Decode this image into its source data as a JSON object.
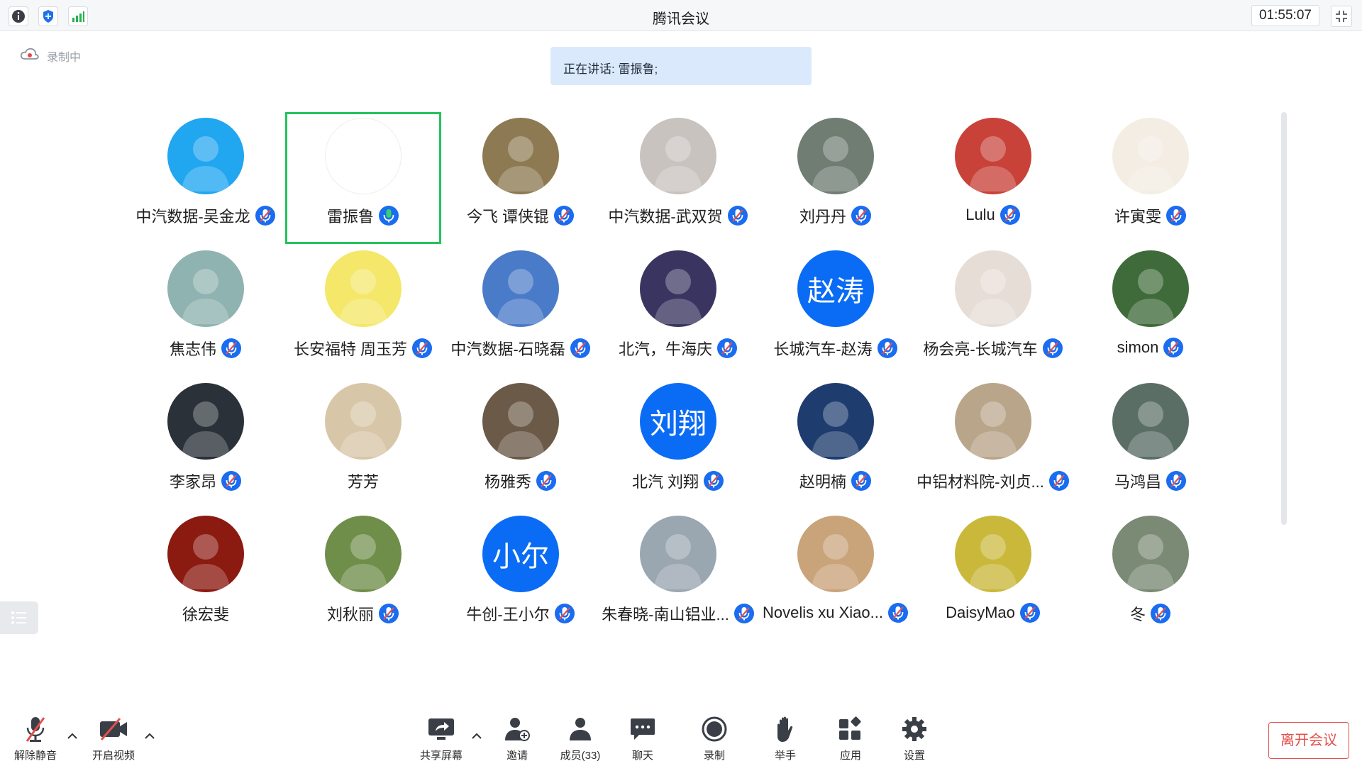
{
  "window": {
    "title": "腾讯会议",
    "timer": "01:55:07",
    "icons": [
      "info-icon",
      "shield-icon",
      "signal-icon"
    ]
  },
  "recording": {
    "label": "录制中"
  },
  "speaking": {
    "prefix": "正在讲话: ",
    "names": "雷振鲁;"
  },
  "participants": [
    {
      "name": "中汽数据-吴金龙",
      "avatar": "photo",
      "bg": "#21a6f0",
      "mic": "muted"
    },
    {
      "name": "雷振鲁",
      "avatar": "photo",
      "bg": "#ffffff",
      "mic": "active"
    },
    {
      "name": "今飞 谭侠锟",
      "avatar": "photo",
      "bg": "#8d7a52",
      "mic": "muted"
    },
    {
      "name": "中汽数据-武双贺",
      "avatar": "photo",
      "bg": "#c9c3bf",
      "mic": "muted"
    },
    {
      "name": "刘丹丹",
      "avatar": "photo",
      "bg": "#6f7d73",
      "mic": "muted"
    },
    {
      "name": "Lulu",
      "avatar": "photo",
      "bg": "#c8423a",
      "mic": "muted"
    },
    {
      "name": "许寅雯",
      "avatar": "photo",
      "bg": "#f3ede3",
      "mic": "muted"
    },
    {
      "name": "焦志伟",
      "avatar": "photo",
      "bg": "#8fb3b0",
      "mic": "muted"
    },
    {
      "name": "长安福特 周玉芳",
      "avatar": "photo",
      "bg": "#f4e76a",
      "mic": "muted"
    },
    {
      "name": "中汽数据-石晓磊",
      "avatar": "photo",
      "bg": "#4a7bc8",
      "mic": "muted"
    },
    {
      "name": "北汽，牛海庆",
      "avatar": "photo",
      "bg": "#3a3560",
      "mic": "muted"
    },
    {
      "name": "长城汽车-赵涛",
      "avatar": "text",
      "text": "赵涛",
      "bg": "#0a6cf5",
      "mic": "muted"
    },
    {
      "name": "杨会亮-长城汽车",
      "avatar": "photo",
      "bg": "#e6ddd6",
      "mic": "muted"
    },
    {
      "name": "simon",
      "avatar": "photo",
      "bg": "#3f6b3a",
      "mic": "muted"
    },
    {
      "name": "李家昂",
      "avatar": "photo",
      "bg": "#2a3138",
      "mic": "muted"
    },
    {
      "name": "芳芳",
      "avatar": "photo",
      "bg": "#d8c6a8",
      "mic": "none"
    },
    {
      "name": "杨雅秀",
      "avatar": "photo",
      "bg": "#6b5a48",
      "mic": "muted"
    },
    {
      "name": "北汽 刘翔",
      "avatar": "text",
      "text": "刘翔",
      "bg": "#0a6cf5",
      "mic": "muted"
    },
    {
      "name": "赵明楠",
      "avatar": "photo",
      "bg": "#1e3c6e",
      "mic": "muted"
    },
    {
      "name": "中铝材料院-刘贞...",
      "avatar": "photo",
      "bg": "#b9a58a",
      "mic": "muted"
    },
    {
      "name": "马鸿昌",
      "avatar": "photo",
      "bg": "#5a6e66",
      "mic": "muted"
    },
    {
      "name": "徐宏斐",
      "avatar": "photo",
      "bg": "#8b1a10",
      "mic": "none"
    },
    {
      "name": "刘秋丽",
      "avatar": "photo",
      "bg": "#6f8e4a",
      "mic": "muted"
    },
    {
      "name": "牛创-王小尔",
      "avatar": "text",
      "text": "小尔",
      "bg": "#0a6cf5",
      "mic": "muted"
    },
    {
      "name": "朱春晓-南山铝业...",
      "avatar": "photo",
      "bg": "#9aa6b0",
      "mic": "muted"
    },
    {
      "name": "Novelis xu Xiao...",
      "avatar": "photo",
      "bg": "#c9a37a",
      "mic": "muted"
    },
    {
      "name": "DaisyMao",
      "avatar": "photo",
      "bg": "#c9b83a",
      "mic": "muted"
    },
    {
      "name": "冬",
      "avatar": "photo",
      "bg": "#7a8a74",
      "mic": "muted"
    }
  ],
  "toolbar": {
    "unmute": "解除静音",
    "video": "开启视频",
    "share": "共享屏幕",
    "invite": "邀请",
    "members": "成员(33)",
    "chat": "聊天",
    "record": "录制",
    "raise_hand": "举手",
    "apps": "应用",
    "settings": "设置",
    "leave": "离开会议"
  },
  "colors": {
    "accent": "#0a6cf5",
    "active_border": "#25c35c",
    "leave": "#e3514c",
    "banner": "#dbe9fc"
  }
}
